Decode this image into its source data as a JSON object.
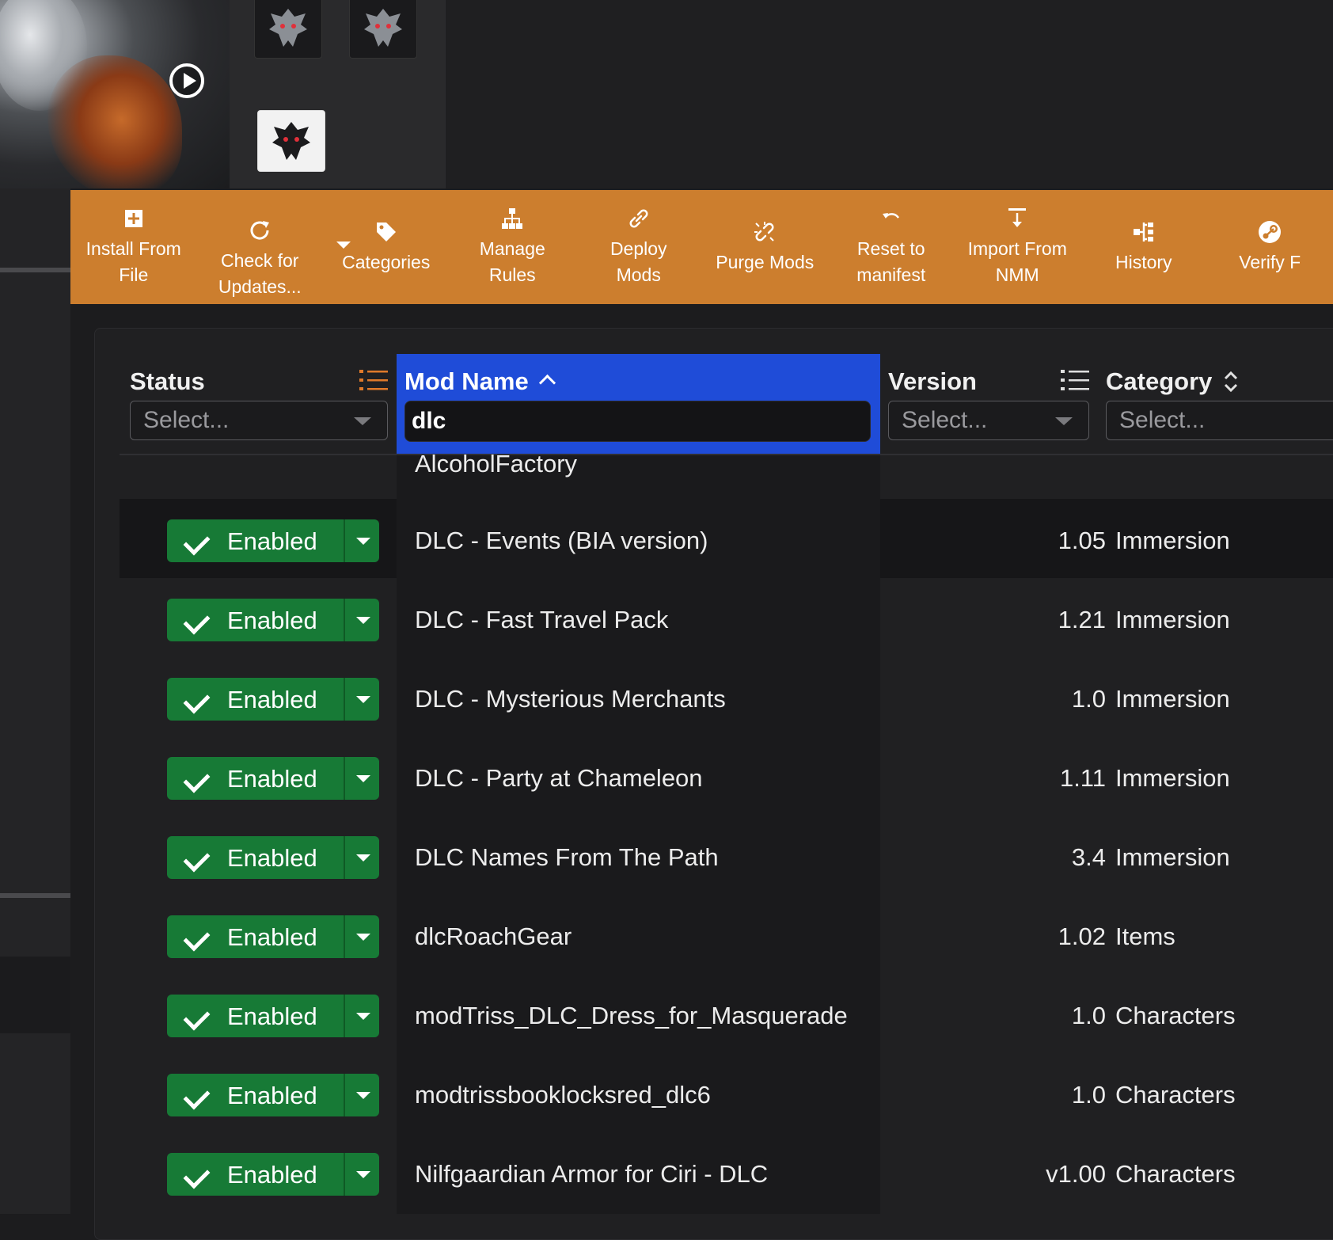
{
  "toolbar": {
    "install_from_file": "Install From\nFile",
    "check_for_updates": "Check for\nUpdates...",
    "categories": "Categories",
    "manage_rules": "Manage\nRules",
    "deploy_mods": "Deploy\nMods",
    "purge_mods": "Purge Mods",
    "reset_to_manifest": "Reset to\nmanifest",
    "import_from_nmm": "Import From\nNMM",
    "history": "History",
    "verify": "Verify F"
  },
  "columns": {
    "status": "Status",
    "mod_name": "Mod Name",
    "version": "Version",
    "category": "Category"
  },
  "filters": {
    "status_placeholder": "Select...",
    "mod_name_value": "dlc",
    "version_placeholder": "Select...",
    "category_placeholder": "Select..."
  },
  "partial_row": "AlcoholFactory",
  "rows": [
    {
      "status": "Enabled",
      "name": "DLC - Events (BIA version)",
      "version": "1.05",
      "category": "Immersion"
    },
    {
      "status": "Enabled",
      "name": "DLC - Fast Travel Pack",
      "version": "1.21",
      "category": "Immersion"
    },
    {
      "status": "Enabled",
      "name": "DLC - Mysterious Merchants",
      "version": "1.0",
      "category": "Immersion"
    },
    {
      "status": "Enabled",
      "name": "DLC - Party at Chameleon",
      "version": "1.11",
      "category": "Immersion"
    },
    {
      "status": "Enabled",
      "name": "DLC Names From The Path",
      "version": "3.4",
      "category": "Immersion"
    },
    {
      "status": "Enabled",
      "name": "dlcRoachGear",
      "version": "1.02",
      "category": "Items"
    },
    {
      "status": "Enabled",
      "name": "modTriss_DLC_Dress_for_Masquerade",
      "version": "1.0",
      "category": "Characters"
    },
    {
      "status": "Enabled",
      "name": "modtrissbooklocksred_dlc6",
      "version": "1.0",
      "category": "Characters"
    },
    {
      "status": "Enabled",
      "name": "Nilfgaardian Armor for Ciri - DLC",
      "version": "v1.00",
      "category": "Characters"
    }
  ],
  "colors": {
    "toolbar": "#cc7e2e",
    "active_column": "#1f4cd8",
    "enabled_green": "#177a36"
  }
}
